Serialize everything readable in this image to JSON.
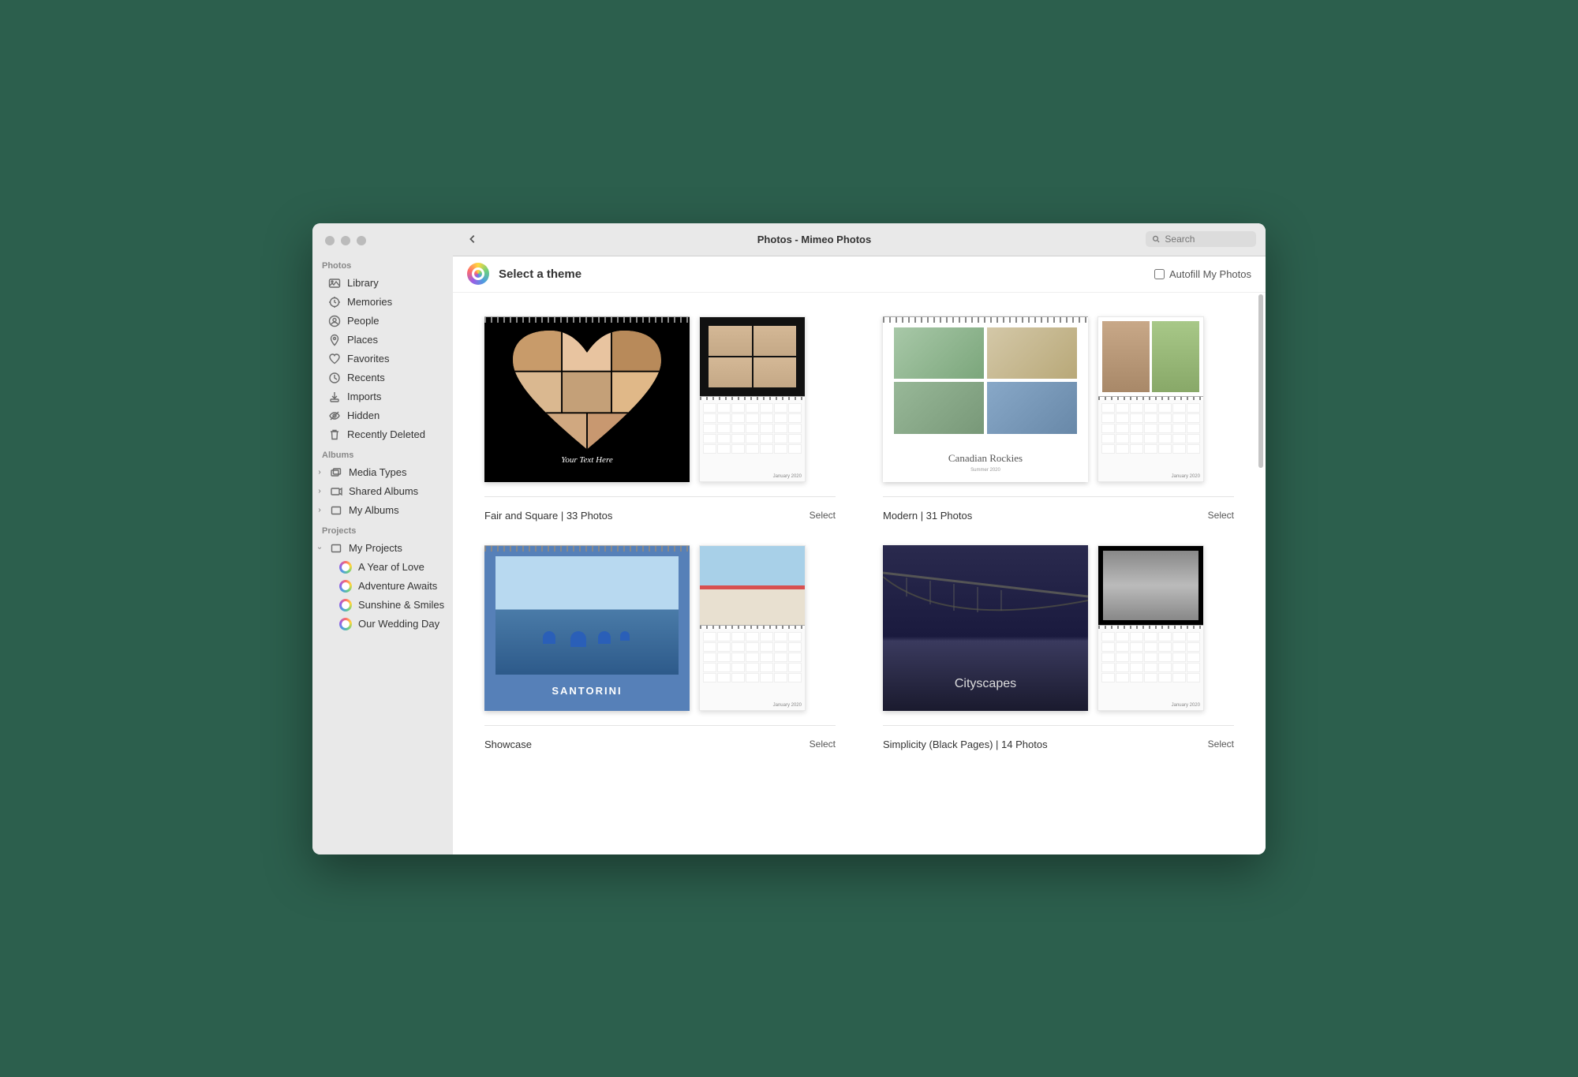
{
  "window": {
    "title": "Photos - Mimeo Photos",
    "search_placeholder": "Search"
  },
  "subheader": {
    "title": "Select a theme",
    "autofill_label": "Autofill My Photos"
  },
  "sidebar": {
    "sections": {
      "photos": {
        "label": "Photos",
        "items": [
          {
            "label": "Library"
          },
          {
            "label": "Memories"
          },
          {
            "label": "People"
          },
          {
            "label": "Places"
          },
          {
            "label": "Favorites"
          },
          {
            "label": "Recents"
          },
          {
            "label": "Imports"
          },
          {
            "label": "Hidden"
          },
          {
            "label": "Recently Deleted"
          }
        ]
      },
      "albums": {
        "label": "Albums",
        "items": [
          {
            "label": "Media Types"
          },
          {
            "label": "Shared Albums"
          },
          {
            "label": "My Albums"
          }
        ]
      },
      "projects": {
        "label": "Projects",
        "my_projects_label": "My Projects",
        "items": [
          {
            "label": "A Year of Love"
          },
          {
            "label": "Adventure Awaits"
          },
          {
            "label": "Sunshine & Smiles"
          },
          {
            "label": "Our Wedding Day"
          }
        ]
      }
    }
  },
  "themes": [
    {
      "name": "Fair and Square | 33 Photos",
      "select": "Select",
      "cover_caption": "Your Text Here",
      "cal_month": "January 2020"
    },
    {
      "name": "Modern | 31 Photos",
      "select": "Select",
      "cover_title": "Canadian Rockies",
      "cover_sub": "Summer 2020",
      "cal_month": "January 2020"
    },
    {
      "name": "Showcase",
      "select": "Select",
      "cover_title": "SANTORINI",
      "cal_month": "January 2020"
    },
    {
      "name": "Simplicity (Black Pages) | 14 Photos",
      "select": "Select",
      "cover_title": "Cityscapes",
      "cal_month": "January 2020"
    }
  ]
}
